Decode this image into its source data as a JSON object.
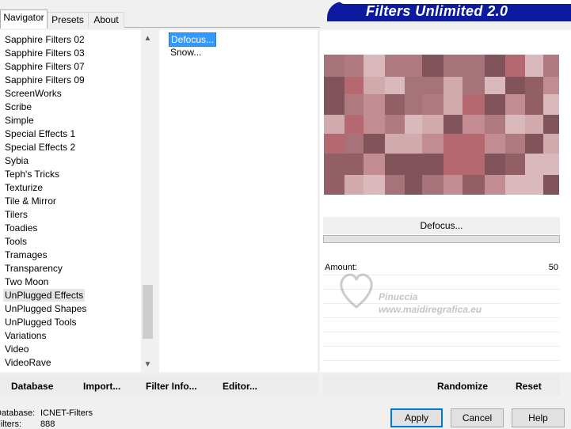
{
  "tabs": [
    {
      "label": "Navigator",
      "active": true
    },
    {
      "label": "Presets",
      "active": false
    },
    {
      "label": "About",
      "active": false
    }
  ],
  "banner": {
    "title": "Filters Unlimited 2.0"
  },
  "categories": [
    {
      "label": "Sapphire Filters 02",
      "selected": false
    },
    {
      "label": "Sapphire Filters 03",
      "selected": false
    },
    {
      "label": "Sapphire Filters 07",
      "selected": false
    },
    {
      "label": "Sapphire Filters 09",
      "selected": false
    },
    {
      "label": "ScreenWorks",
      "selected": false
    },
    {
      "label": "Scribe",
      "selected": false
    },
    {
      "label": "Simple",
      "selected": false
    },
    {
      "label": "Special Effects 1",
      "selected": false
    },
    {
      "label": "Special Effects 2",
      "selected": false
    },
    {
      "label": "Sybia",
      "selected": false
    },
    {
      "label": "Teph's Tricks",
      "selected": false
    },
    {
      "label": "Texturize",
      "selected": false
    },
    {
      "label": "Tile & Mirror",
      "selected": false
    },
    {
      "label": "Tilers",
      "selected": false
    },
    {
      "label": "Toadies",
      "selected": false
    },
    {
      "label": "Tools",
      "selected": false
    },
    {
      "label": "Tramages",
      "selected": false
    },
    {
      "label": "Transparency",
      "selected": false
    },
    {
      "label": "Two Moon",
      "selected": false
    },
    {
      "label": "UnPlugged Effects",
      "selected": true
    },
    {
      "label": "UnPlugged Shapes",
      "selected": false
    },
    {
      "label": "UnPlugged Tools",
      "selected": false
    },
    {
      "label": "Variations",
      "selected": false
    },
    {
      "label": "Video",
      "selected": false
    },
    {
      "label": "VideoRave",
      "selected": false
    }
  ],
  "filters": [
    {
      "label": "Defocus...",
      "selected": true
    },
    {
      "label": "Snow...",
      "selected": false
    }
  ],
  "preview": {
    "filter_name": "Defocus...",
    "params": [
      {
        "label": "Amount:",
        "value": "50"
      }
    ],
    "colors": {
      "base": "#a6737a",
      "light": "#d8b4b6",
      "dark": "#7a4d55",
      "red": "#b8666e"
    }
  },
  "watermark": {
    "line1": "Pinuccia",
    "line2": "www.maidiregrafica.eu"
  },
  "left_buttons": {
    "database": "Database",
    "import": "Import...",
    "filter_info": "Filter Info...",
    "editor": "Editor..."
  },
  "right_buttons": {
    "randomize": "Randomize",
    "reset": "Reset"
  },
  "status": {
    "database_label": "Database:",
    "database_value": "ICNET-Filters",
    "filters_label": "Filters:",
    "filters_value": "888"
  },
  "dialog_buttons": {
    "apply": "Apply",
    "cancel": "Cancel",
    "help": "Help"
  }
}
